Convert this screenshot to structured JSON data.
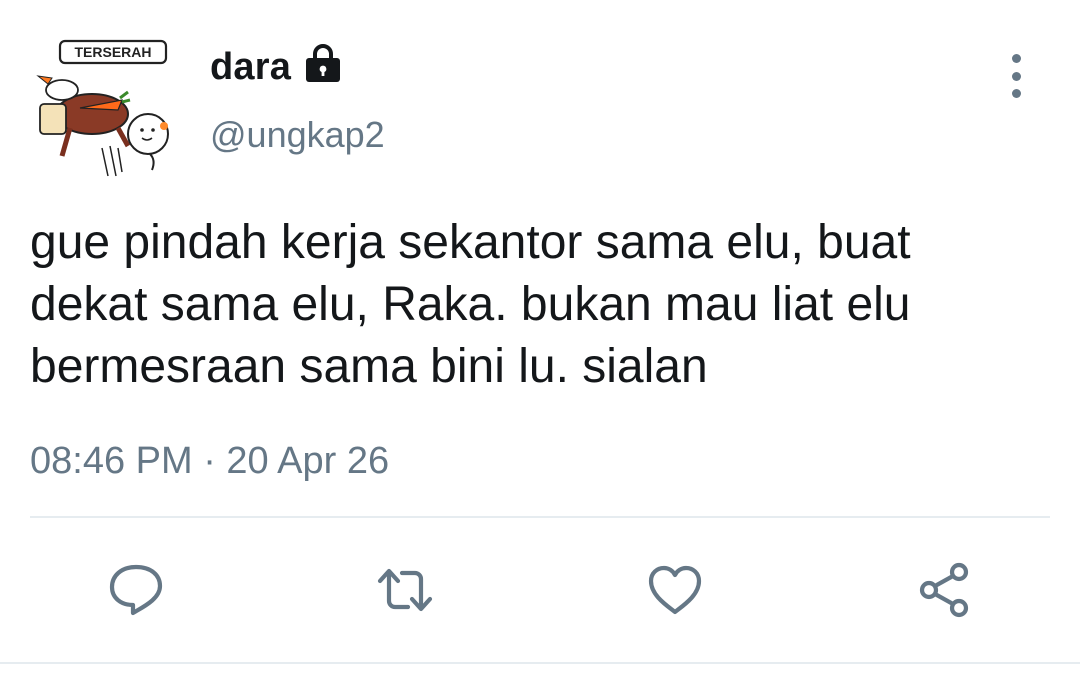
{
  "tweet": {
    "avatar": {
      "badge_text": "TERSERAH",
      "icon": "cartoon-avatar"
    },
    "user": {
      "display_name": "dara",
      "handle": "@ungkap2",
      "protected_icon": "lock-icon"
    },
    "menu_icon": "more-vertical-icon",
    "text": "gue pindah kerja sekantor sama elu, buat\ndekat sama elu, Raka. bukan mau liat elu\nbermesraan sama bini lu. sialan",
    "timestamp": "08:46 PM · 20 Apr 26",
    "actions": [
      {
        "name": "reply",
        "icon": "comment-icon"
      },
      {
        "name": "retweet",
        "icon": "retweet-icon"
      },
      {
        "name": "like",
        "icon": "heart-icon"
      },
      {
        "name": "share",
        "icon": "share-icon"
      }
    ]
  },
  "colors": {
    "primary_text": "#14171a",
    "secondary_text": "#657786",
    "divider": "#e6ecf0"
  }
}
